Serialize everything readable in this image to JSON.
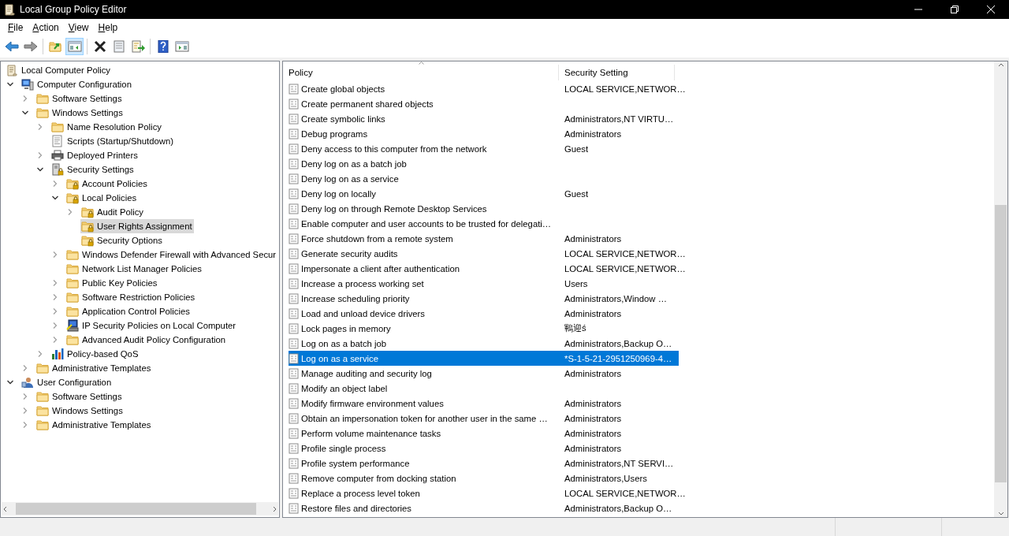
{
  "window": {
    "title": "Local Group Policy Editor"
  },
  "menu": [
    "File",
    "Action",
    "View",
    "Help"
  ],
  "toolbar": [
    {
      "kind": "back",
      "pressed": false
    },
    {
      "kind": "forward",
      "pressed": false
    },
    {
      "kind": "separator"
    },
    {
      "kind": "up",
      "pressed": false
    },
    {
      "kind": "tree",
      "pressed": true
    },
    {
      "kind": "separator"
    },
    {
      "kind": "delete",
      "pressed": false
    },
    {
      "kind": "properties",
      "pressed": false
    },
    {
      "kind": "export",
      "pressed": false
    },
    {
      "kind": "separator"
    },
    {
      "kind": "help",
      "pressed": false
    },
    {
      "kind": "pane",
      "pressed": false
    }
  ],
  "tree": [
    {
      "label": "Local Computer Policy",
      "kind": "scroll",
      "selected": false,
      "children": [
        {
          "label": "Computer Configuration",
          "kind": "computer",
          "expanded": true,
          "selected": false,
          "children": [
            {
              "label": "Software Settings",
              "kind": "folder",
              "expanded": false,
              "selected": false
            },
            {
              "label": "Windows Settings",
              "kind": "folder",
              "expanded": true,
              "selected": false,
              "children": [
                {
                  "label": "Name Resolution Policy",
                  "kind": "folder",
                  "expanded": false,
                  "selected": false
                },
                {
                  "label": "Scripts (Startup/Shutdown)",
                  "kind": "script",
                  "selected": false
                },
                {
                  "label": "Deployed Printers",
                  "kind": "printer",
                  "expanded": false,
                  "selected": false
                },
                {
                  "label": "Security Settings",
                  "kind": "security",
                  "expanded": true,
                  "selected": false,
                  "children": [
                    {
                      "label": "Account Policies",
                      "kind": "lockfolder",
                      "expanded": false,
                      "selected": false
                    },
                    {
                      "label": "Local Policies",
                      "kind": "lockfolder",
                      "expanded": true,
                      "selected": false,
                      "children": [
                        {
                          "label": "Audit Policy",
                          "kind": "lockfolder",
                          "expanded": false,
                          "selected": false
                        },
                        {
                          "label": "User Rights Assignment",
                          "kind": "lockfolder",
                          "selected": true
                        },
                        {
                          "label": "Security Options",
                          "kind": "lockfolder",
                          "selected": false
                        }
                      ]
                    },
                    {
                      "label": "Windows Defender Firewall with Advanced Secur",
                      "kind": "folder",
                      "expanded": false,
                      "selected": false
                    },
                    {
                      "label": "Network List Manager Policies",
                      "kind": "folder",
                      "selected": false
                    },
                    {
                      "label": "Public Key Policies",
                      "kind": "folder",
                      "expanded": false,
                      "selected": false
                    },
                    {
                      "label": "Software Restriction Policies",
                      "kind": "folder",
                      "expanded": false,
                      "selected": false
                    },
                    {
                      "label": "Application Control Policies",
                      "kind": "folder",
                      "expanded": false,
                      "selected": false
                    },
                    {
                      "label": "IP Security Policies on Local Computer",
                      "kind": "ipsec",
                      "expanded": false,
                      "selected": false
                    },
                    {
                      "label": "Advanced Audit Policy Configuration",
                      "kind": "folder",
                      "expanded": false,
                      "selected": false
                    }
                  ]
                },
                {
                  "label": "Policy-based QoS",
                  "kind": "chart",
                  "expanded": false,
                  "selected": false
                }
              ]
            },
            {
              "label": "Administrative Templates",
              "kind": "folder",
              "expanded": false,
              "selected": false
            }
          ]
        },
        {
          "label": "User Configuration",
          "kind": "user",
          "expanded": true,
          "selected": false,
          "children": [
            {
              "label": "Software Settings",
              "kind": "folder",
              "expanded": false,
              "selected": false
            },
            {
              "label": "Windows Settings",
              "kind": "folder",
              "expanded": false,
              "selected": false
            },
            {
              "label": "Administrative Templates",
              "kind": "folder",
              "expanded": false,
              "selected": false
            }
          ]
        }
      ]
    }
  ],
  "table": {
    "columns": [
      "Policy",
      "Security Setting"
    ],
    "rows": [
      {
        "policy": "Create global objects",
        "setting": "LOCAL SERVICE,NETWOR…",
        "selected": false
      },
      {
        "policy": "Create permanent shared objects",
        "selected": false
      },
      {
        "policy": "Create symbolic links",
        "setting": "Administrators,NT VIRTU…",
        "selected": false
      },
      {
        "policy": "Debug programs",
        "setting": "Administrators",
        "selected": false
      },
      {
        "policy": "Deny access to this computer from the network",
        "setting": "Guest",
        "selected": false
      },
      {
        "policy": "Deny log on as a batch job",
        "selected": false
      },
      {
        "policy": "Deny log on as a service",
        "selected": false
      },
      {
        "policy": "Deny log on locally",
        "setting": "Guest",
        "selected": false
      },
      {
        "policy": "Deny log on through Remote Desktop Services",
        "selected": false
      },
      {
        "policy": "Enable computer and user accounts to be trusted for delegati…",
        "selected": false
      },
      {
        "policy": "Force shutdown from a remote system",
        "setting": "Administrators",
        "selected": false
      },
      {
        "policy": "Generate security audits",
        "setting": "LOCAL SERVICE,NETWOR…",
        "selected": false
      },
      {
        "policy": "Impersonate a client after authentication",
        "setting": "LOCAL SERVICE,NETWOR…",
        "selected": false
      },
      {
        "policy": "Increase a process working set",
        "setting": "Users",
        "selected": false
      },
      {
        "policy": "Increase scheduling priority",
        "setting": "Administrators,Window …",
        "selected": false
      },
      {
        "policy": "Load and unload device drivers",
        "setting": "Administrators",
        "selected": false
      },
      {
        "policy": "Lock pages in memory",
        "setting": "鶤迎ś",
        "selected": false
      },
      {
        "policy": "Log on as a batch job",
        "setting": "Administrators,Backup O…",
        "selected": false
      },
      {
        "policy": "Log on as a service",
        "setting": "*S-1-5-21-2951250969-4…",
        "selected": true
      },
      {
        "policy": "Manage auditing and security log",
        "setting": "Administrators",
        "selected": false
      },
      {
        "policy": "Modify an object label",
        "selected": false
      },
      {
        "policy": "Modify firmware environment values",
        "setting": "Administrators",
        "selected": false
      },
      {
        "policy": "Obtain an impersonation token for another user in the same …",
        "setting": "Administrators",
        "selected": false
      },
      {
        "policy": "Perform volume maintenance tasks",
        "setting": "Administrators",
        "selected": false
      },
      {
        "policy": "Profile single process",
        "setting": "Administrators",
        "selected": false
      },
      {
        "policy": "Profile system performance",
        "setting": "Administrators,NT SERVI…",
        "selected": false
      },
      {
        "policy": "Remove computer from docking station",
        "setting": "Administrators,Users",
        "selected": false
      },
      {
        "policy": "Replace a process level token",
        "setting": "LOCAL SERVICE,NETWOR…",
        "selected": false
      },
      {
        "policy": "Restore files and directories",
        "setting": "Administrators,Backup O…",
        "selected": false
      }
    ]
  }
}
